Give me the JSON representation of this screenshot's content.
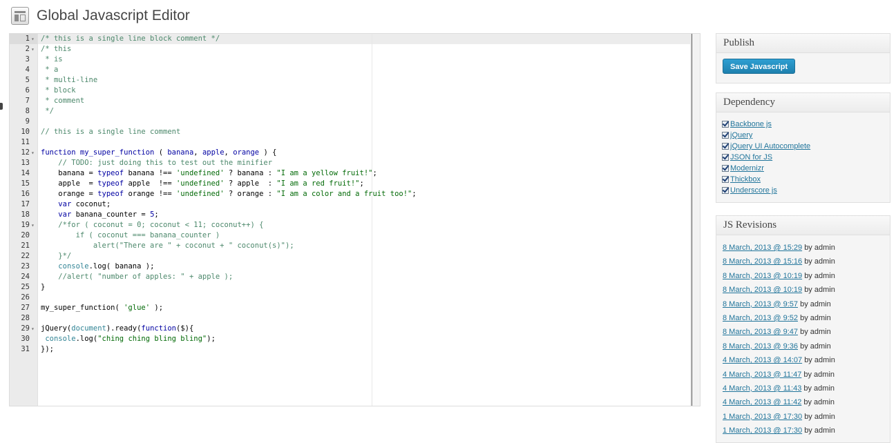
{
  "header": {
    "title": "Global Javascript Editor",
    "icon": "page-layout-icon"
  },
  "editor": {
    "lines": [
      {
        "n": "1",
        "fold": "▾",
        "tokens": [
          [
            "comment",
            "/* this is a single line block comment */"
          ]
        ]
      },
      {
        "n": "2",
        "fold": "▾",
        "tokens": [
          [
            "comment",
            "/* this"
          ]
        ]
      },
      {
        "n": "3",
        "fold": "",
        "tokens": [
          [
            "comment",
            " * is"
          ]
        ]
      },
      {
        "n": "4",
        "fold": "",
        "tokens": [
          [
            "comment",
            " * a"
          ]
        ]
      },
      {
        "n": "5",
        "fold": "",
        "tokens": [
          [
            "comment",
            " * multi-line"
          ]
        ]
      },
      {
        "n": "6",
        "fold": "",
        "tokens": [
          [
            "comment",
            " * block"
          ]
        ]
      },
      {
        "n": "7",
        "fold": "",
        "tokens": [
          [
            "comment",
            " * comment"
          ]
        ]
      },
      {
        "n": "8",
        "fold": "",
        "tokens": [
          [
            "comment",
            " */"
          ]
        ]
      },
      {
        "n": "9",
        "fold": "",
        "tokens": []
      },
      {
        "n": "10",
        "fold": "",
        "tokens": [
          [
            "comment",
            "// this is a single line comment"
          ]
        ]
      },
      {
        "n": "11",
        "fold": "",
        "tokens": []
      },
      {
        "n": "12",
        "fold": "▾",
        "tokens": [
          [
            "keyword",
            "function"
          ],
          [
            "text",
            " "
          ],
          [
            "keyword",
            "my_super_function"
          ],
          [
            "text",
            " ( "
          ],
          [
            "param",
            "banana"
          ],
          [
            "text",
            ", "
          ],
          [
            "param",
            "apple"
          ],
          [
            "text",
            ", "
          ],
          [
            "param",
            "orange"
          ],
          [
            "text",
            " ) {"
          ]
        ]
      },
      {
        "n": "13",
        "fold": "",
        "tokens": [
          [
            "text",
            "    "
          ],
          [
            "comment",
            "// TODO: just doing this to test out the minifier"
          ]
        ]
      },
      {
        "n": "14",
        "fold": "",
        "tokens": [
          [
            "text",
            "    banana = "
          ],
          [
            "keyword",
            "typeof"
          ],
          [
            "text",
            " banana !== "
          ],
          [
            "string2",
            "'undefined'"
          ],
          [
            "text",
            " ? banana : "
          ],
          [
            "string2",
            "\"I am a yellow fruit!\""
          ],
          [
            "text",
            ";"
          ]
        ]
      },
      {
        "n": "15",
        "fold": "",
        "tokens": [
          [
            "text",
            "    apple  = "
          ],
          [
            "keyword",
            "typeof"
          ],
          [
            "text",
            " apple  !== "
          ],
          [
            "string2",
            "'undefined'"
          ],
          [
            "text",
            " ? apple  : "
          ],
          [
            "string2",
            "\"I am a red fruit!\""
          ],
          [
            "text",
            ";"
          ]
        ]
      },
      {
        "n": "16",
        "fold": "",
        "tokens": [
          [
            "text",
            "    orange = "
          ],
          [
            "keyword",
            "typeof"
          ],
          [
            "text",
            " orange !== "
          ],
          [
            "string2",
            "'undefined'"
          ],
          [
            "text",
            " ? orange : "
          ],
          [
            "string2",
            "\"I am a color and a fruit too!\""
          ],
          [
            "text",
            ";"
          ]
        ]
      },
      {
        "n": "17",
        "fold": "",
        "tokens": [
          [
            "text",
            "    "
          ],
          [
            "keyword",
            "var"
          ],
          [
            "text",
            " coconut;"
          ]
        ]
      },
      {
        "n": "18",
        "fold": "",
        "tokens": [
          [
            "text",
            "    "
          ],
          [
            "keyword",
            "var"
          ],
          [
            "text",
            " banana_counter = "
          ],
          [
            "keyword",
            "5"
          ],
          [
            "text",
            ";"
          ]
        ]
      },
      {
        "n": "19",
        "fold": "▾",
        "tokens": [
          [
            "text",
            "    "
          ],
          [
            "comment",
            "/*for ( coconut = 0; coconut < 11; coconut++) {"
          ]
        ]
      },
      {
        "n": "20",
        "fold": "",
        "tokens": [
          [
            "comment",
            "        if ( coconut === banana_counter )"
          ]
        ]
      },
      {
        "n": "21",
        "fold": "",
        "tokens": [
          [
            "comment",
            "            alert(\"There are \" + coconut + \" coconut(s)\");"
          ]
        ]
      },
      {
        "n": "22",
        "fold": "",
        "tokens": [
          [
            "comment",
            "    }*/"
          ]
        ]
      },
      {
        "n": "23",
        "fold": "",
        "tokens": [
          [
            "text",
            "    "
          ],
          [
            "builtin",
            "console"
          ],
          [
            "text",
            ".log( banana );"
          ]
        ]
      },
      {
        "n": "24",
        "fold": "",
        "tokens": [
          [
            "text",
            "    "
          ],
          [
            "comment",
            "//alert( \"number of apples: \" + apple );"
          ]
        ]
      },
      {
        "n": "25",
        "fold": "",
        "tokens": [
          [
            "text",
            "}"
          ]
        ]
      },
      {
        "n": "26",
        "fold": "",
        "tokens": []
      },
      {
        "n": "27",
        "fold": "",
        "tokens": [
          [
            "text",
            "my_super_function( "
          ],
          [
            "string2",
            "'glue'"
          ],
          [
            "text",
            " );"
          ]
        ]
      },
      {
        "n": "28",
        "fold": "",
        "tokens": []
      },
      {
        "n": "29",
        "fold": "▾",
        "tokens": [
          [
            "text",
            "jQuery("
          ],
          [
            "builtin",
            "document"
          ],
          [
            "text",
            ").ready("
          ],
          [
            "keyword",
            "function"
          ],
          [
            "text",
            "($){"
          ]
        ]
      },
      {
        "n": "30",
        "fold": "",
        "tokens": [
          [
            "text",
            " "
          ],
          [
            "builtin",
            "console"
          ],
          [
            "text",
            ".log("
          ],
          [
            "string2",
            "\"ching ching bling bling\""
          ],
          [
            "text",
            ");"
          ]
        ]
      },
      {
        "n": "31",
        "fold": "",
        "tokens": [
          [
            "text",
            "});"
          ]
        ]
      }
    ]
  },
  "publish": {
    "title": "Publish",
    "save_label": "Save Javascript"
  },
  "dependency": {
    "title": "Dependency",
    "items": [
      "Backbone js ",
      "jQuery ",
      "jQuery UI Autocomplete ",
      "JSON for JS ",
      "Modernizr ",
      "Thickbox ",
      "Underscore js "
    ]
  },
  "revisions": {
    "title": "JS Revisions",
    "by_text": "by admin",
    "items": [
      "8 March, 2013 @ 15:29",
      "8 March, 2013 @ 15:16",
      "8 March, 2013 @ 10:19",
      "8 March, 2013 @ 10:19",
      "8 March, 2013 @ 9:57",
      "8 March, 2013 @ 9:52",
      "8 March, 2013 @ 9:47",
      "8 March, 2013 @ 9:36",
      "4 March, 2013 @ 14:07",
      "4 March, 2013 @ 11:47",
      "4 March, 2013 @ 11:43",
      "4 March, 2013 @ 11:42",
      "1 March, 2013 @ 17:30",
      "1 March, 2013 @ 17:30"
    ]
  }
}
